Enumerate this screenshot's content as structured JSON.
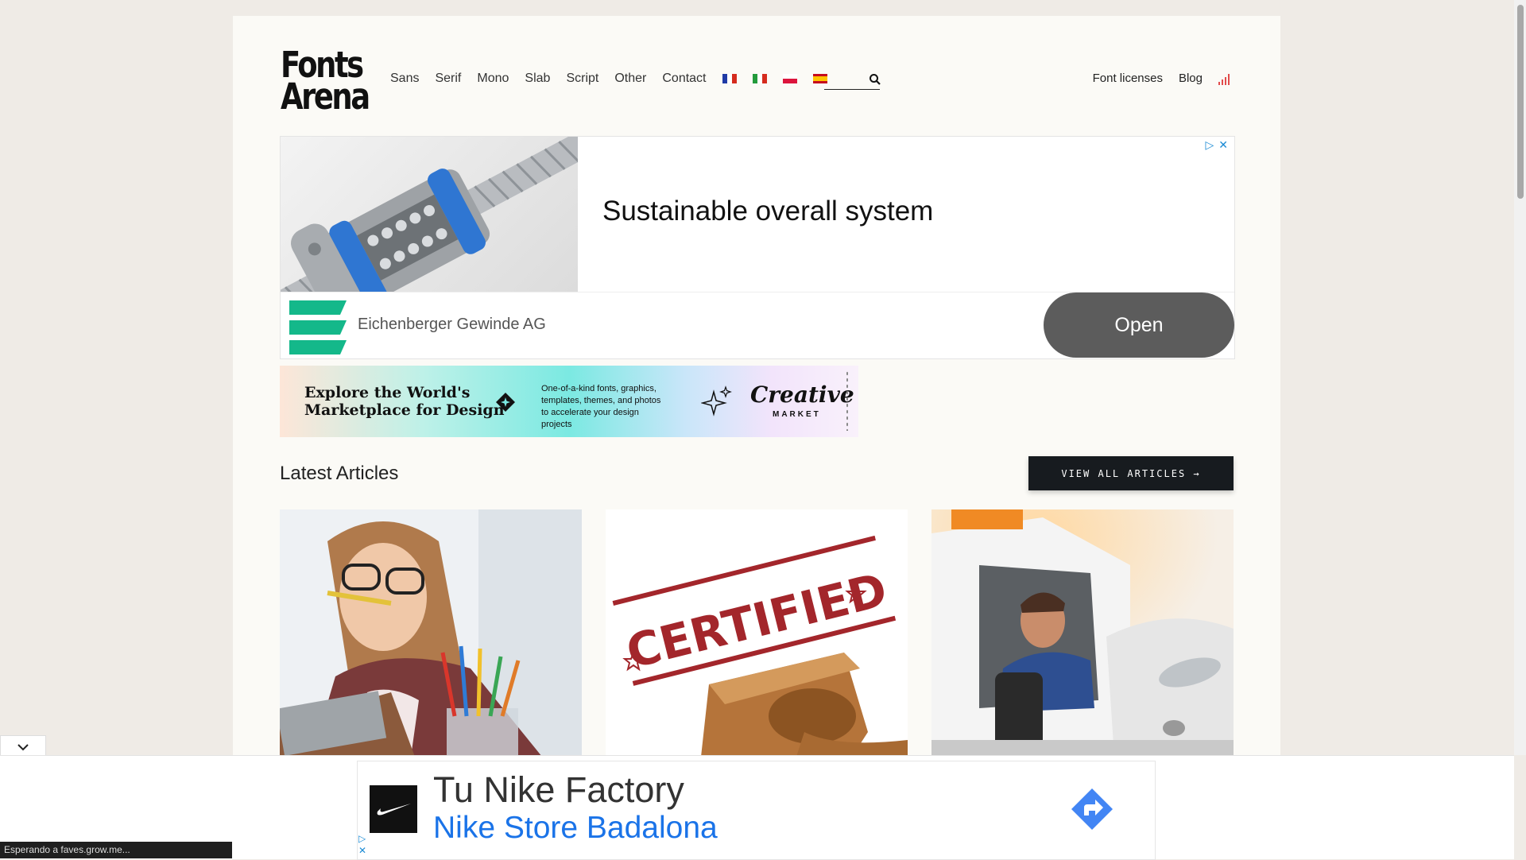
{
  "header": {
    "logo_line1": "Fonts",
    "logo_line2": "Arena",
    "nav": [
      "Sans",
      "Serif",
      "Mono",
      "Slab",
      "Script",
      "Other",
      "Contact"
    ],
    "flags": [
      "fr",
      "it",
      "pl",
      "es"
    ],
    "search_placeholder": "",
    "right_nav": [
      "Font licenses",
      "Blog"
    ]
  },
  "ad_top": {
    "headline": "Sustainable overall system",
    "advertiser": "Eichenberger Gewinde AG",
    "button": "Open",
    "brand_color": "#14b88a"
  },
  "ad_banner": {
    "headline_line1": "Explore the World's",
    "headline_line2": "Marketplace for Design",
    "body": "One-of-a-kind fonts, graphics, templates, themes, and photos to accelerate your design projects",
    "brand_line1": "Creative",
    "brand_line2": "MARKET"
  },
  "articles": {
    "title": "Latest Articles",
    "view_all": "VIEW ALL ARTICLES →",
    "cards": [
      {
        "image": "woman-biting-pencil"
      },
      {
        "image": "certified-stamp",
        "stamp_text": "CERTIFIED"
      },
      {
        "image": "man-in-van"
      }
    ]
  },
  "bottom_ad": {
    "line1": "Tu Nike Factory",
    "line2": "Nike Store Badalona"
  },
  "status_bar": "Esperando a faves.grow.me..."
}
